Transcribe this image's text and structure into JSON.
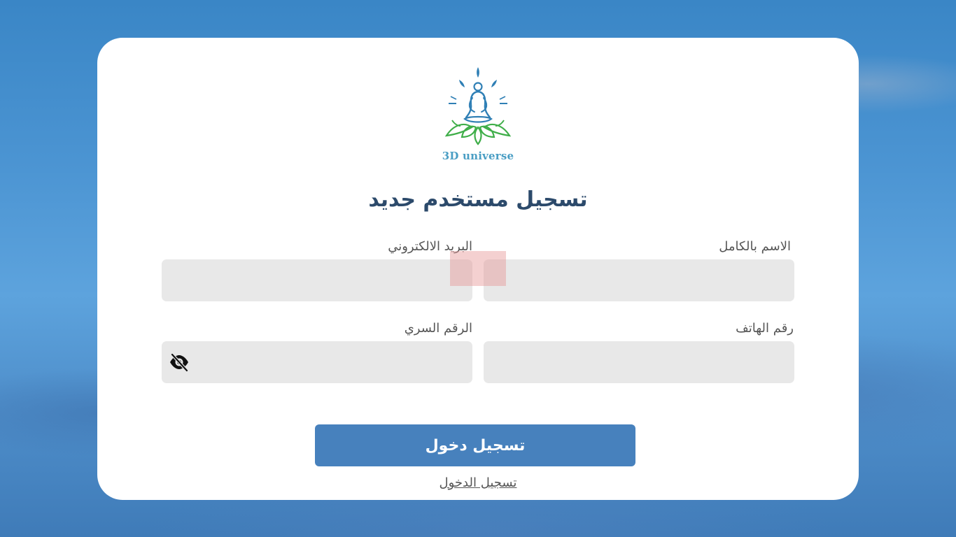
{
  "brand": {
    "logo_text": "3D universe",
    "colors": {
      "logo_blue": "#2f7fb5",
      "logo_green": "#3fae49",
      "text_blue": "#4a9ec4"
    }
  },
  "form": {
    "title": "تسجيل مستخدم جديد",
    "fields": {
      "full_name": {
        "label": "الاسم بالكامل",
        "value": ""
      },
      "email": {
        "label": "البريد الالكتروني",
        "value": ""
      },
      "phone": {
        "label": "رقم الهاتف",
        "value": ""
      },
      "password": {
        "label": "الرقم السري",
        "value": "",
        "toggle_icon": "eye-slash-icon"
      }
    },
    "submit_label": "تسجيل دخول",
    "login_link": "تسجيل الدخول"
  },
  "colors": {
    "primary_button": "#4781bd",
    "title": "#2c4a6b",
    "input_bg": "#e8e8e8",
    "card_bg": "#ffffff"
  }
}
